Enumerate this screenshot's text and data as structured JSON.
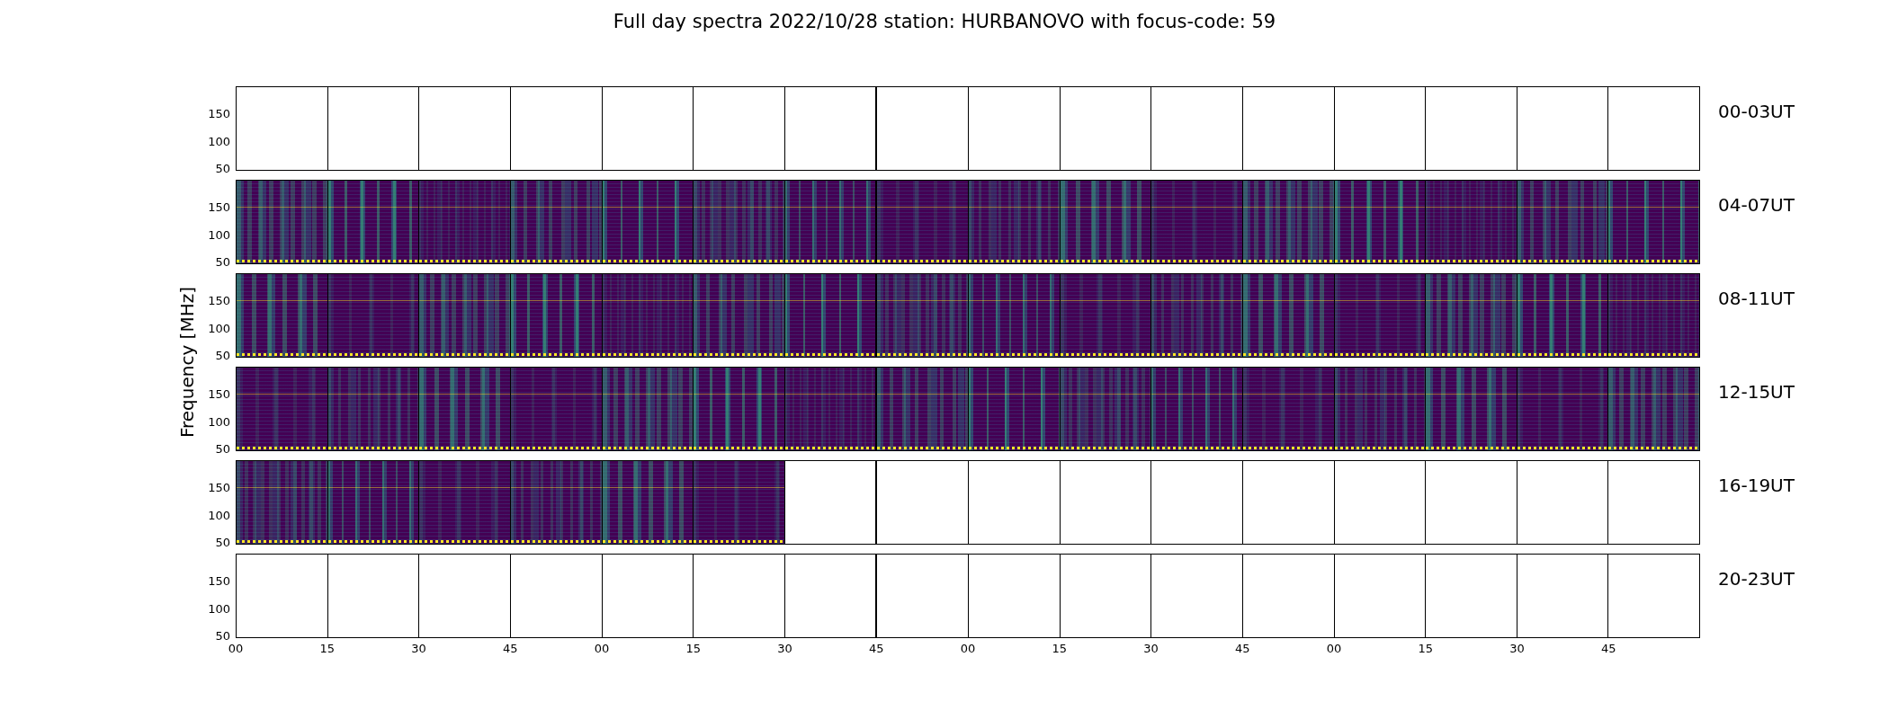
{
  "title": "Full day spectra 2022/10/28 station: HURBANOVO with focus-code: 59",
  "ylabel": "Frequency [MHz]",
  "xticks": [
    "00",
    "15",
    "30",
    "45",
    "00",
    "15",
    "30",
    "45",
    "00",
    "15",
    "30",
    "45",
    "00",
    "15",
    "30",
    "45"
  ],
  "rows": [
    {
      "label": "00-03UT",
      "yticks": [
        "150",
        "100",
        "50"
      ],
      "panels": [
        {
          "filled": false
        },
        {
          "filled": false
        },
        {
          "filled": false
        },
        {
          "filled": false
        },
        {
          "filled": false
        },
        {
          "filled": false
        },
        {
          "filled": false
        },
        {
          "filled": false
        },
        {
          "filled": false
        },
        {
          "filled": false
        },
        {
          "filled": false
        },
        {
          "filled": false
        },
        {
          "filled": false
        },
        {
          "filled": false
        },
        {
          "filled": false
        },
        {
          "filled": false
        }
      ]
    },
    {
      "label": "04-07UT",
      "yticks": [
        "150",
        "100",
        "50"
      ],
      "panels": [
        {
          "filled": true
        },
        {
          "filled": true
        },
        {
          "filled": true
        },
        {
          "filled": true
        },
        {
          "filled": true
        },
        {
          "filled": true
        },
        {
          "filled": true
        },
        {
          "filled": true
        },
        {
          "filled": true
        },
        {
          "filled": true
        },
        {
          "filled": true
        },
        {
          "filled": true
        },
        {
          "filled": true
        },
        {
          "filled": true
        },
        {
          "filled": true
        },
        {
          "filled": true
        }
      ]
    },
    {
      "label": "08-11UT",
      "yticks": [
        "150",
        "100",
        "50"
      ],
      "panels": [
        {
          "filled": true
        },
        {
          "filled": true
        },
        {
          "filled": true
        },
        {
          "filled": true
        },
        {
          "filled": true
        },
        {
          "filled": true
        },
        {
          "filled": true
        },
        {
          "filled": true
        },
        {
          "filled": true
        },
        {
          "filled": true
        },
        {
          "filled": true
        },
        {
          "filled": true
        },
        {
          "filled": true
        },
        {
          "filled": true
        },
        {
          "filled": true
        },
        {
          "filled": true
        }
      ]
    },
    {
      "label": "12-15UT",
      "yticks": [
        "150",
        "100",
        "50"
      ],
      "panels": [
        {
          "filled": true
        },
        {
          "filled": true
        },
        {
          "filled": true
        },
        {
          "filled": true
        },
        {
          "filled": true
        },
        {
          "filled": true
        },
        {
          "filled": true
        },
        {
          "filled": true
        },
        {
          "filled": true
        },
        {
          "filled": true
        },
        {
          "filled": true
        },
        {
          "filled": true
        },
        {
          "filled": true
        },
        {
          "filled": true
        },
        {
          "filled": true
        },
        {
          "filled": true
        }
      ]
    },
    {
      "label": "16-19UT",
      "yticks": [
        "150",
        "100",
        "50"
      ],
      "panels": [
        {
          "filled": true
        },
        {
          "filled": true
        },
        {
          "filled": true
        },
        {
          "filled": true
        },
        {
          "filled": true
        },
        {
          "filled": true
        },
        {
          "filled": false
        },
        {
          "filled": false
        },
        {
          "filled": false
        },
        {
          "filled": false
        },
        {
          "filled": false
        },
        {
          "filled": false
        },
        {
          "filled": false
        },
        {
          "filled": false
        },
        {
          "filled": false
        },
        {
          "filled": false
        }
      ]
    },
    {
      "label": "20-23UT",
      "yticks": [
        "150",
        "100",
        "50"
      ],
      "panels": [
        {
          "filled": false
        },
        {
          "filled": false
        },
        {
          "filled": false
        },
        {
          "filled": false
        },
        {
          "filled": false
        },
        {
          "filled": false
        },
        {
          "filled": false
        },
        {
          "filled": false
        },
        {
          "filled": false
        },
        {
          "filled": false
        },
        {
          "filled": false
        },
        {
          "filled": false
        },
        {
          "filled": false
        },
        {
          "filled": false
        },
        {
          "filled": false
        },
        {
          "filled": false
        }
      ]
    }
  ]
}
